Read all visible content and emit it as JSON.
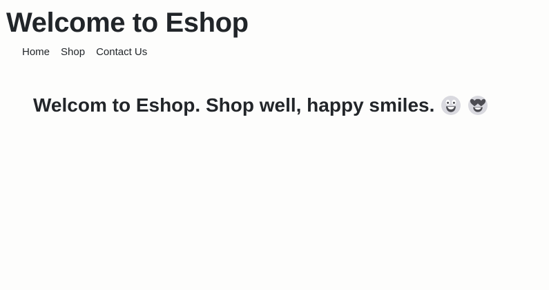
{
  "header": {
    "title": "Welcome to Eshop"
  },
  "nav": {
    "items": [
      {
        "label": "Home"
      },
      {
        "label": "Shop"
      },
      {
        "label": "Contact Us"
      }
    ]
  },
  "main": {
    "welcome_text": "Welcom to Eshop. Shop well, happy smiles.",
    "emojis": [
      {
        "icon": "grinning-face-icon"
      },
      {
        "icon": "heart-eyes-face-icon"
      }
    ]
  },
  "colors": {
    "background": "#fdfdfc",
    "text": "#212529",
    "emoji_face": "#d9d9df",
    "emoji_features": "#4c4c52"
  }
}
